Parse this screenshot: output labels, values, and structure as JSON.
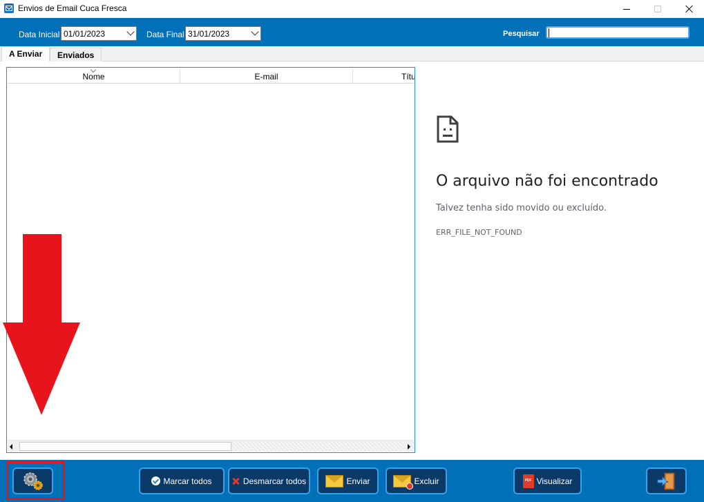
{
  "window": {
    "title": "Envios de Email Cuca Fresca",
    "controls": [
      "minimize",
      "maximize",
      "close"
    ]
  },
  "filters": {
    "data_inicial_label": "Data Inicial",
    "data_inicial_value": "01/01/2023",
    "data_final_label": "Data Final",
    "data_final_value": "31/01/2023",
    "search_label": "Pesquisar",
    "search_value": ""
  },
  "tabs": [
    {
      "label": "A Enviar",
      "active": true
    },
    {
      "label": "Enviados",
      "active": false
    }
  ],
  "grid": {
    "columns": [
      "Nome",
      "E-mail",
      "Títu"
    ],
    "rows": []
  },
  "error_page": {
    "title": "O arquivo não foi encontrado",
    "subtitle": "Talvez tenha sido movido ou excluído.",
    "code": "ERR_FILE_NOT_FOUND"
  },
  "toolbar": {
    "settings_icon": "gears-icon",
    "marcar_todos": "Marcar todos",
    "desmarcar_todos": "Desmarcar todos",
    "enviar": "Enviar",
    "excluir": "Excluir",
    "visualizar": "Visualizar",
    "exit_icon": "door-exit-icon"
  },
  "annotation": {
    "arrow_color": "#e8141c",
    "highlight_color": "#e8141c"
  },
  "colors": {
    "bar_blue": "#0070b8",
    "button_bg": "#0b3a68",
    "button_border": "#3aa0e8"
  }
}
